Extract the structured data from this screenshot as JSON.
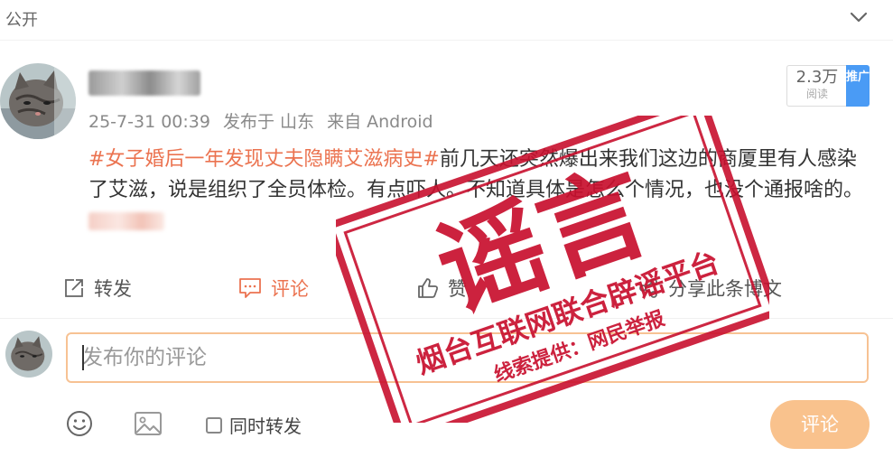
{
  "topbar": {
    "visibility": "公开",
    "collapse_icon": "chevron-down-icon"
  },
  "post": {
    "author": "█████",
    "meta": {
      "time": "25-7-31 00:39",
      "location": "发布于 山东",
      "source": "来自 Android"
    },
    "reads": {
      "count": "2.3万",
      "label": "阅读"
    },
    "promote_label": "推广",
    "hashtag": "#女子婚后一年发现丈夫隐瞒艾滋病史#",
    "text": "前几天还突然爆出来我们这边的商厦里有人感染了艾滋，说是组织了全员体检。有点吓人。不知道具体是怎么个情况，也没个通报啥的。",
    "blurred_tail": "███"
  },
  "actions": {
    "forward": "转发",
    "comment": "评论",
    "like": "赞",
    "share": "分享此条博文"
  },
  "comment_box": {
    "placeholder": "发布你的评论",
    "repost_label": "同时转发",
    "submit_label": "评论"
  },
  "stamp": {
    "main": "谣言",
    "org": "烟台互联网联合辟谣平台",
    "clue": "线索提供：网民举报",
    "color": "#c8102e"
  },
  "colors": {
    "accent": "#eb7350",
    "promote": "#4a9bf5",
    "submit": "#f9c28d",
    "input_border": "#f7c293"
  }
}
